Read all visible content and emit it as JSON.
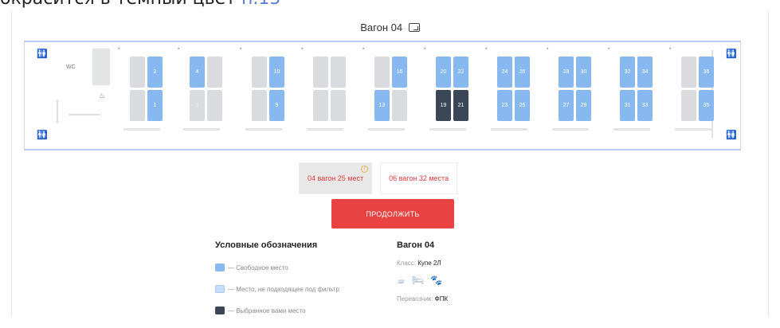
{
  "top_caption": {
    "text": "окрасится в темный цвет",
    "link": "п.15"
  },
  "wagon_title": "Вагон 04",
  "map": {
    "wc_label": "WC",
    "seats": [
      {
        "n": "2",
        "state": "free"
      },
      {
        "n": "1",
        "state": "free"
      },
      {
        "n": "4",
        "state": "free"
      },
      {
        "n": "3",
        "state": "filter"
      },
      {
        "n": "10",
        "state": "free"
      },
      {
        "n": "9",
        "state": "free"
      },
      {
        "n": "16",
        "state": "free"
      },
      {
        "n": "13",
        "state": "free"
      },
      {
        "n": "20",
        "state": "free"
      },
      {
        "n": "22",
        "state": "free"
      },
      {
        "n": "19",
        "state": "selected"
      },
      {
        "n": "21",
        "state": "selected"
      },
      {
        "n": "24",
        "state": "free"
      },
      {
        "n": "26",
        "state": "free"
      },
      {
        "n": "23",
        "state": "free"
      },
      {
        "n": "25",
        "state": "free"
      },
      {
        "n": "28",
        "state": "free"
      },
      {
        "n": "30",
        "state": "free"
      },
      {
        "n": "27",
        "state": "free"
      },
      {
        "n": "29",
        "state": "free"
      },
      {
        "n": "32",
        "state": "free"
      },
      {
        "n": "34",
        "state": "free"
      },
      {
        "n": "31",
        "state": "free"
      },
      {
        "n": "33",
        "state": "free"
      },
      {
        "n": "36",
        "state": "free"
      },
      {
        "n": "35",
        "state": "free"
      }
    ]
  },
  "wagon_tabs": [
    {
      "label": "04 вагон 25 мест",
      "active": true
    },
    {
      "label": "06 вагон 32 места",
      "active": false
    }
  ],
  "continue_label": "ПРОДОЛЖИТЬ",
  "legend": {
    "title": "Условные обозначения",
    "items": [
      {
        "label": "— Свободное место",
        "color": "#87b9f0"
      },
      {
        "label": "— Место, не подходящее под фильтр",
        "color": "#c7def8"
      },
      {
        "label": "— Выбранное вами место",
        "color": "#3b4756"
      }
    ]
  },
  "info": {
    "title": "Вагон 04",
    "class_label": "Класс:",
    "class_value": "Купе 2Л",
    "amenities": [
      "coffee-icon",
      "bed-icon",
      "pet-icon"
    ],
    "carrier_label": "Перевозчик:",
    "carrier_value": "ФПК"
  },
  "colors": {
    "free": "#87b9f0",
    "filter": "#d9dbdf",
    "selected": "#3b4756",
    "accent": "#e84342"
  }
}
